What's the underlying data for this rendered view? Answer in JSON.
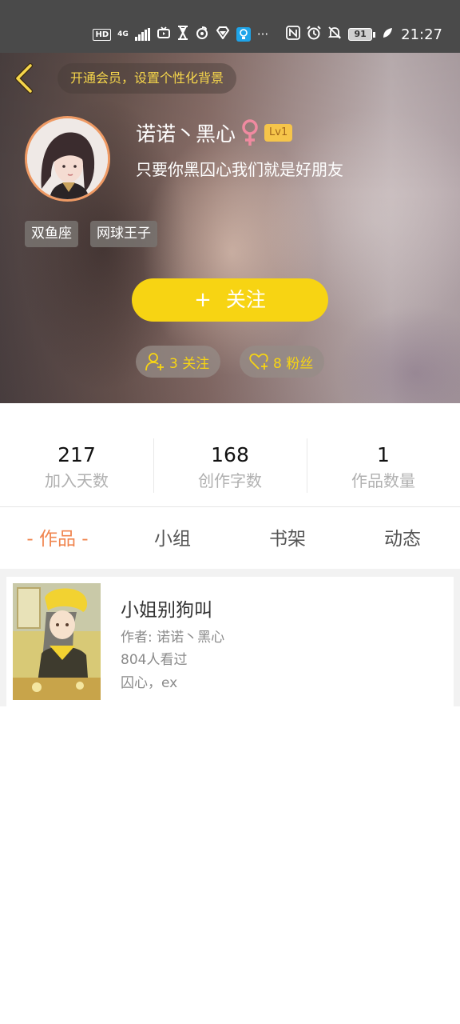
{
  "status_bar": {
    "hd_label": "HD",
    "network_label": "4G",
    "battery_level": "91",
    "time": "21:27",
    "icons": [
      "hd-icon",
      "signal-icon",
      "tv-icon",
      "hourglass-icon",
      "netease-icon",
      "diamond-icon",
      "bulb-app-icon",
      "more-icon",
      "nfc-icon",
      "alarm-icon",
      "mute-icon",
      "battery-icon",
      "leaf-icon"
    ]
  },
  "header": {
    "vip_banner": "开通会员，设置个性化背景"
  },
  "profile": {
    "name": "诺诺丶黑心",
    "gender_icon": "female-icon",
    "level": "Lv1",
    "bio": "只要你黑囚心我们就是好朋友",
    "tags": [
      "双鱼座",
      "网球王子"
    ],
    "follow_label": "关注",
    "follow_plus": "+",
    "following_label": "3 关注",
    "fans_label": "8 粉丝"
  },
  "stats": [
    {
      "value": "217",
      "label": "加入天数"
    },
    {
      "value": "168",
      "label": "创作字数"
    },
    {
      "value": "1",
      "label": "作品数量"
    }
  ],
  "tabs": [
    {
      "label": "- 作品 -",
      "active": true
    },
    {
      "label": "小组",
      "active": false
    },
    {
      "label": "书架",
      "active": false
    },
    {
      "label": "动态",
      "active": false
    }
  ],
  "works": [
    {
      "title": "小姐别狗叫",
      "author": "作者: 诺诺丶黑心",
      "views": "804人看过",
      "tags": "囚心，ex"
    }
  ],
  "colors": {
    "accent_yellow": "#f7d413",
    "tab_active": "#f0854f",
    "avatar_border": "#ef9a64",
    "female_icon": "#f08aa0"
  }
}
